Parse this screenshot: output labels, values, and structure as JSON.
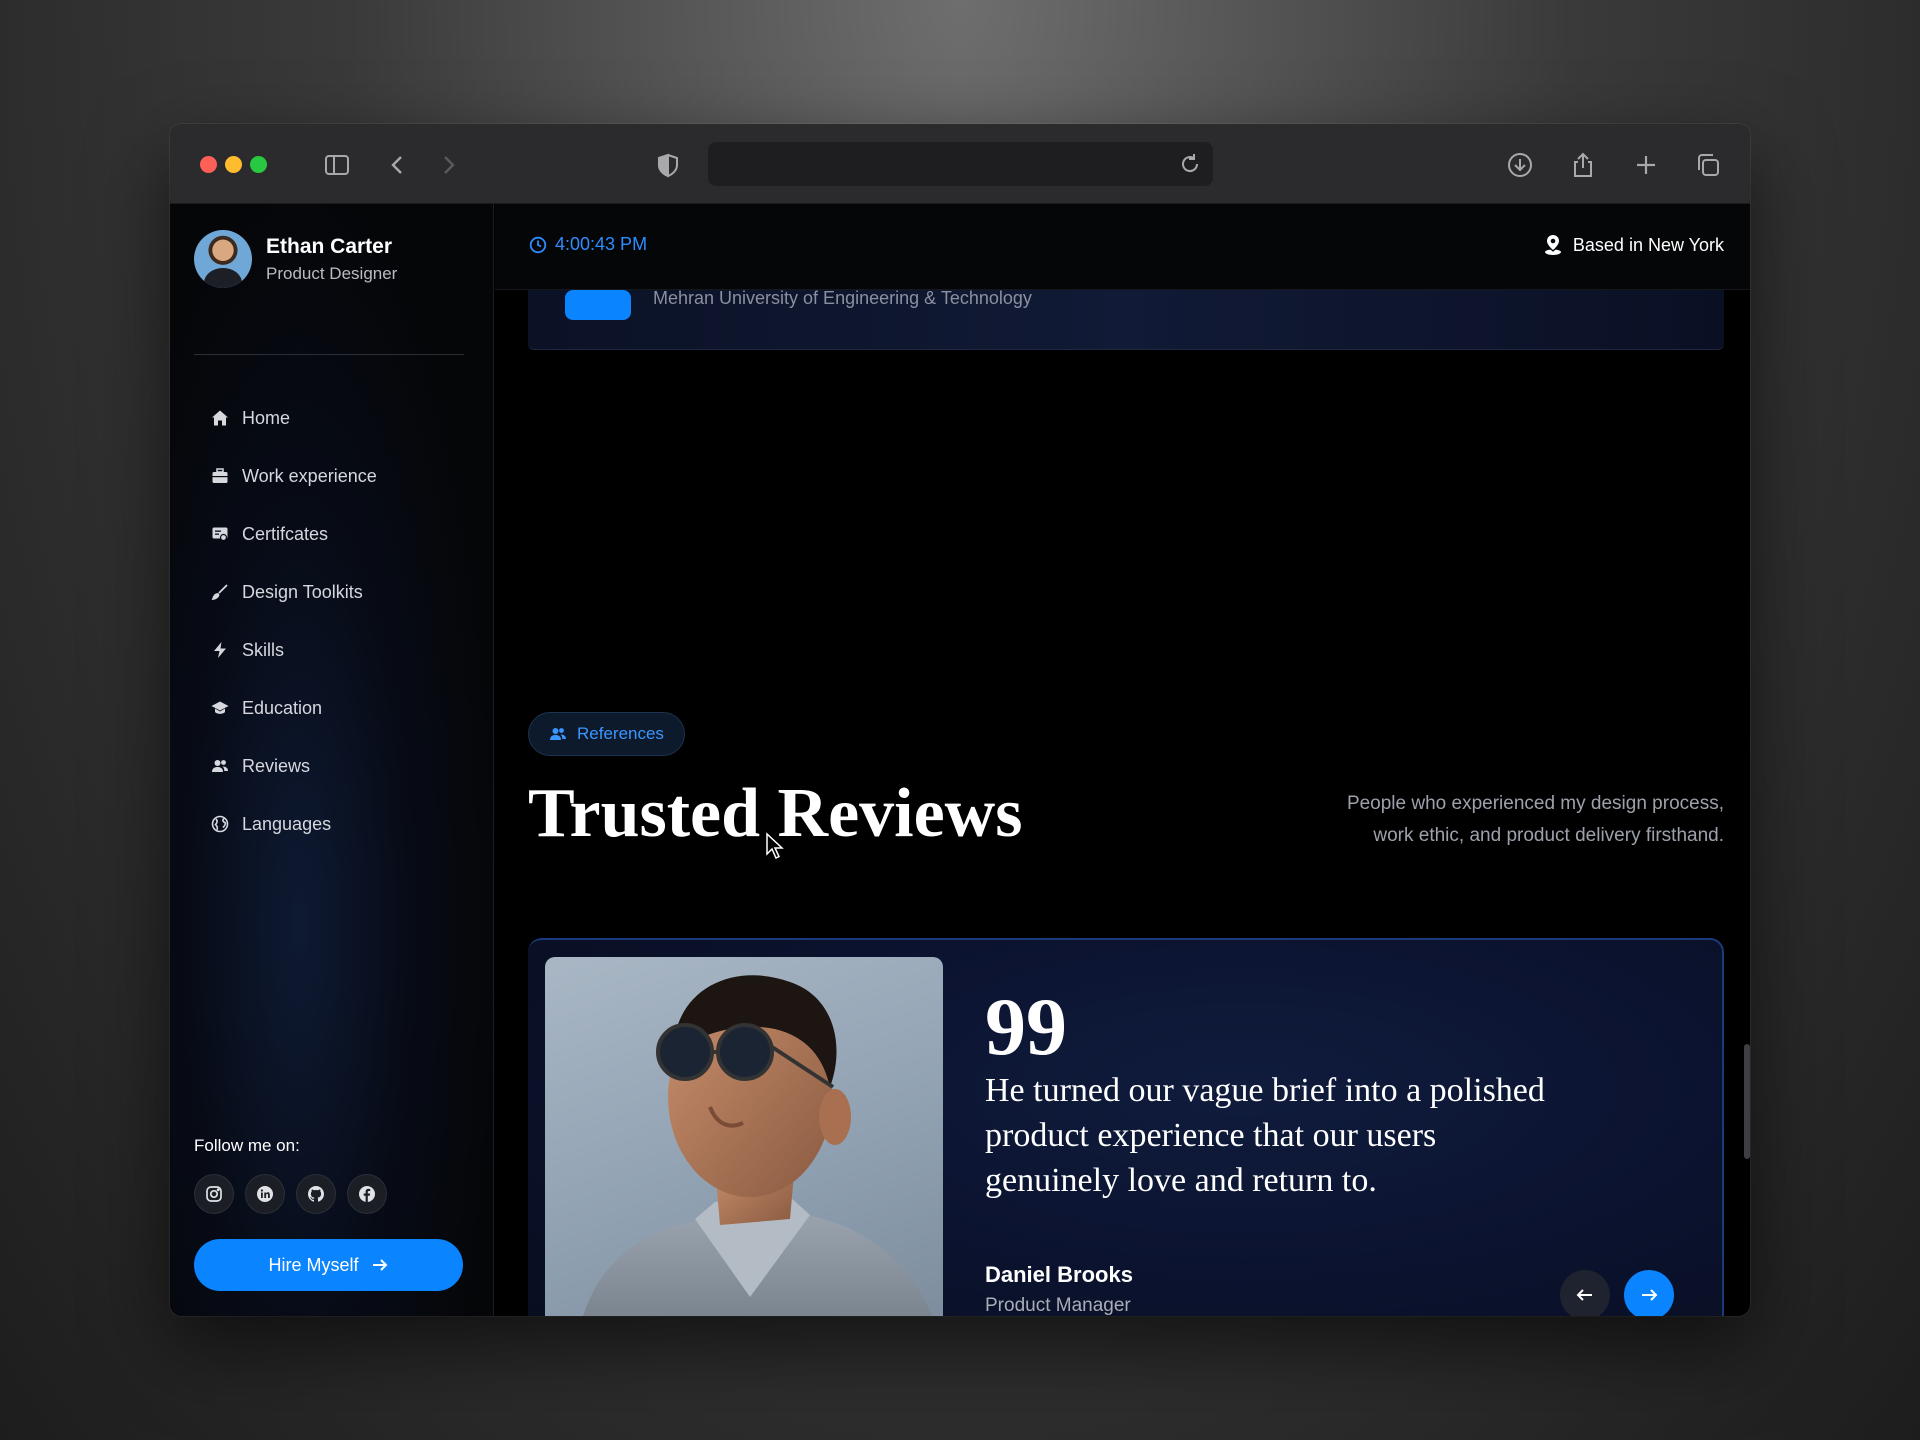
{
  "profile": {
    "name": "Ethan Carter",
    "role": "Product Designer"
  },
  "nav": [
    {
      "label": "Home",
      "icon": "home-icon"
    },
    {
      "label": "Work experience",
      "icon": "briefcase-icon"
    },
    {
      "label": "Certifcates",
      "icon": "certificate-icon"
    },
    {
      "label": "Design Toolkits",
      "icon": "brush-icon"
    },
    {
      "label": "Skills",
      "icon": "lightning-icon"
    },
    {
      "label": "Education",
      "icon": "graduation-cap-icon"
    },
    {
      "label": "Reviews",
      "icon": "users-icon"
    },
    {
      "label": "Languages",
      "icon": "globe-icon"
    }
  ],
  "follow": {
    "label": "Follow me on:",
    "networks": [
      "instagram-icon",
      "linkedin-icon",
      "github-icon",
      "facebook-icon"
    ]
  },
  "hire": {
    "label": "Hire Myself"
  },
  "topbar": {
    "time": "4:00:43 PM",
    "location": "Based in New York"
  },
  "education_peek": {
    "text": "Mehran University of Engineering & Technology"
  },
  "references": {
    "pill": "References",
    "title": "Trusted Reviews",
    "description": "People who experienced my design process, work ethic, and product delivery firsthand."
  },
  "review": {
    "quote_mark": "99",
    "quote": "He turned our vague brief into a polished product experience that our users genuinely love and return to.",
    "name": "Daniel Brooks",
    "role": "Product Manager"
  },
  "colors": {
    "accent": "#0a84ff",
    "background": "#000000",
    "card": "#0b1330"
  }
}
